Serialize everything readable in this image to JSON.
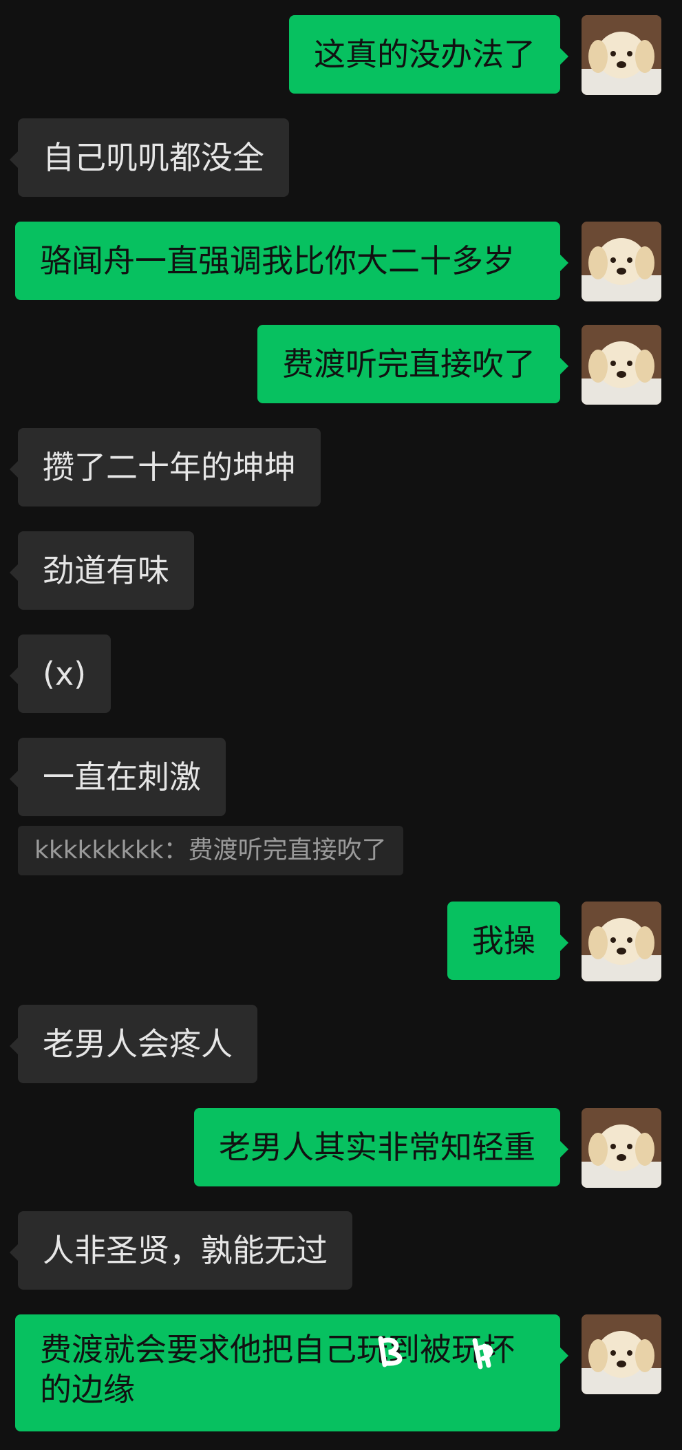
{
  "messages": [
    {
      "side": "out",
      "text": "这真的没办法了"
    },
    {
      "side": "in",
      "text": "自己叽叽都没全"
    },
    {
      "side": "out",
      "text": "骆闻舟一直强调我比你大二十多岁"
    },
    {
      "side": "out",
      "text": "费渡听完直接吹了"
    },
    {
      "side": "in",
      "text": "攒了二十年的坤坤"
    },
    {
      "side": "in",
      "text": "劲道有味"
    },
    {
      "side": "in",
      "text": "(x)"
    },
    {
      "side": "in",
      "text": "一直在刺激"
    },
    {
      "side": "out",
      "text": "我操"
    },
    {
      "side": "in",
      "text": "老男人会疼人"
    },
    {
      "side": "out",
      "text": "老男人其实非常知轻重"
    },
    {
      "side": "in",
      "text": "人非圣贤，孰能无过"
    },
    {
      "side": "out",
      "text": "费渡就会要求他把自己玩到被玩坏的边缘"
    }
  ],
  "quote": {
    "sender": "kkkkkkkkk",
    "separator": "：",
    "text": "费渡听完直接吹了"
  },
  "avatar": {
    "icon": "puppy-avatar-icon"
  },
  "colors": {
    "background": "#111111",
    "outgoing_bubble": "#07c160",
    "incoming_bubble": "#2b2b2b",
    "quote_bg": "#262626"
  }
}
